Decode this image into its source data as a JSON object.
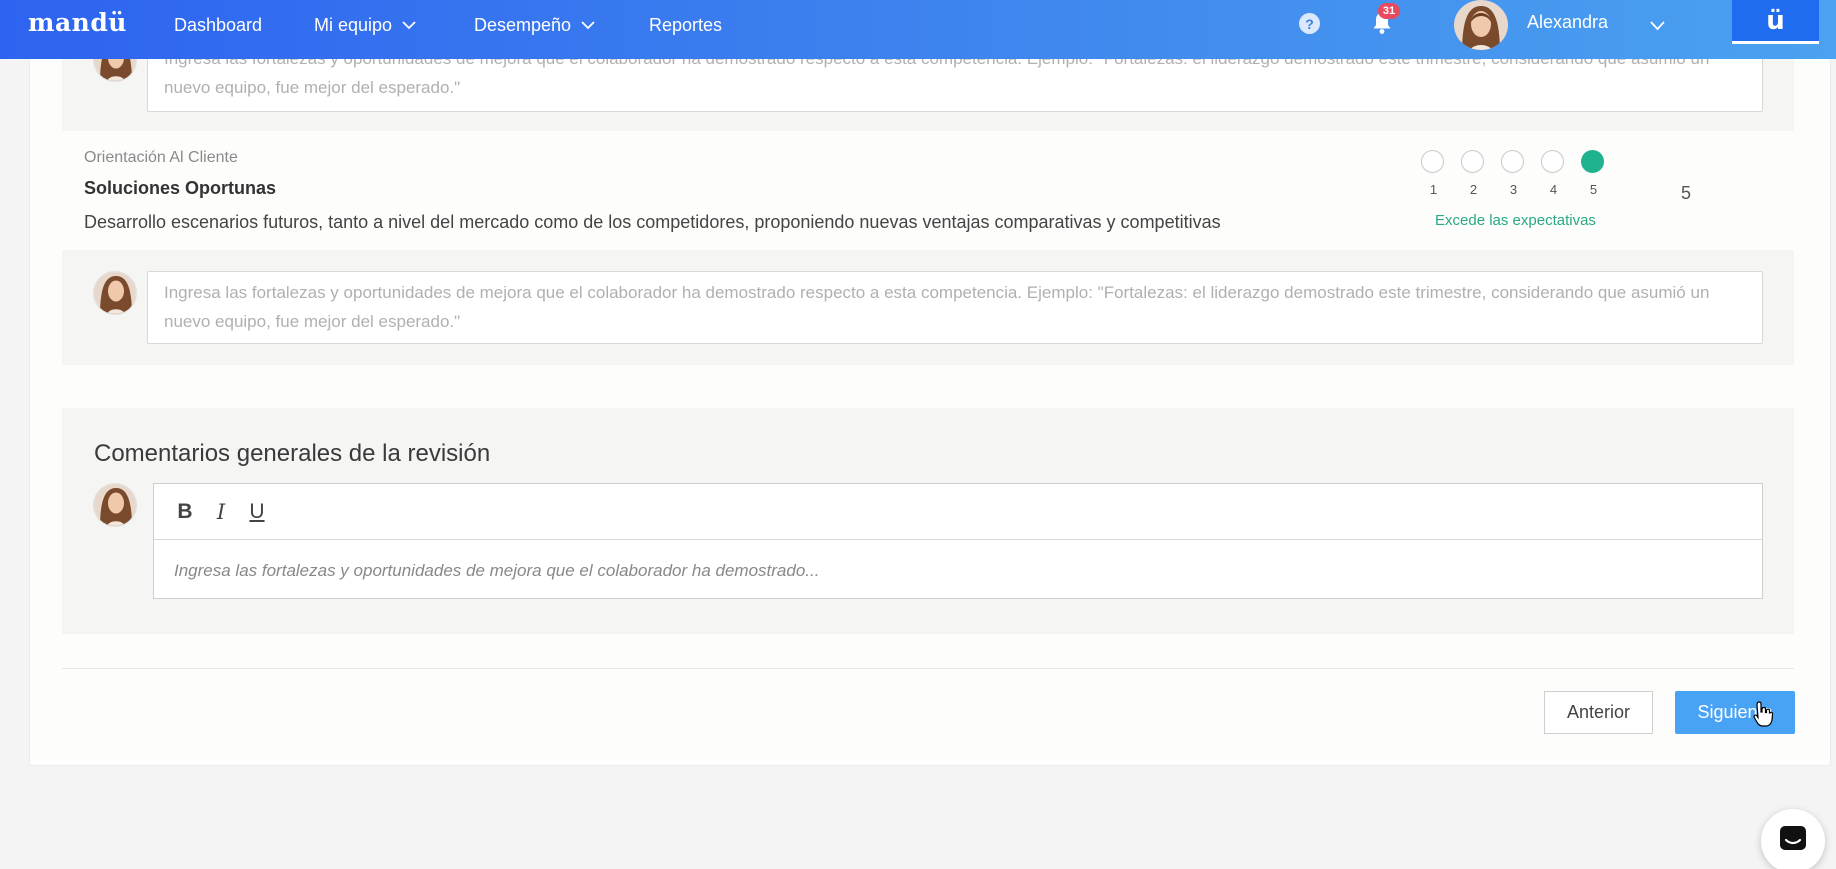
{
  "nav": {
    "brand": "mandü",
    "items": [
      {
        "label": "Dashboard"
      },
      {
        "label": "Mi equipo"
      },
      {
        "label": "Desempeño"
      },
      {
        "label": "Reportes"
      }
    ],
    "help_icon": "question-circle-icon",
    "notifications": {
      "icon": "bell-icon",
      "count": "31"
    },
    "user": {
      "name": "Alexandra"
    },
    "brand_button": "ü"
  },
  "competency": {
    "previous_comment_placeholder": "Ingresa las fortalezas y oportunidades de mejora que el colaborador ha demostrado respecto a esta competencia. Ejemplo: \"Fortalezas: el liderazgo demostrado este trimestre, considerando que asumió un nuevo equipo, fue mejor del esperado.\"",
    "category": "Orientación Al Cliente",
    "title": "Soluciones Oportunas",
    "description": "Desarrollo escenarios futuros, tanto a nivel del mercado como de los competidores, proponiendo nuevas ventajas comparativas y competitivas",
    "rating": {
      "options": [
        "1",
        "2",
        "3",
        "4",
        "5"
      ],
      "selected": 5,
      "label": "Excede las expectativas",
      "score": "5"
    },
    "comment_placeholder": "Ingresa las fortalezas y oportunidades de mejora que el colaborador ha demostrado respecto a esta competencia. Ejemplo: \"Fortalezas: el liderazgo demostrado este trimestre, considerando que asumió un nuevo equipo, fue mejor del esperado.\""
  },
  "general": {
    "title": "Comentarios generales de la revisión",
    "toolbar": {
      "bold": "B",
      "italic": "I",
      "underline": "U"
    },
    "placeholder": "Ingresa las fortalezas y oportunidades de mejora que el colaborador ha demostrado..."
  },
  "actions": {
    "previous": "Anterior",
    "next": "Siguiente"
  },
  "colors": {
    "accent": "#49a3f5",
    "selected_rating": "#1fb28f"
  }
}
